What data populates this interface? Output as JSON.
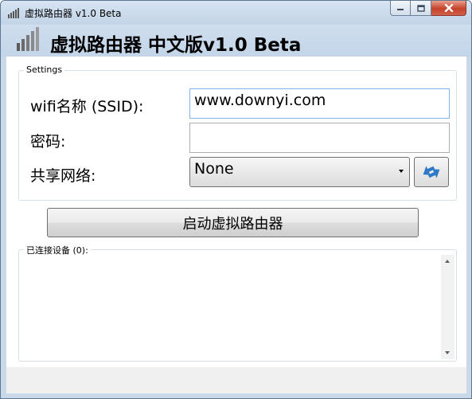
{
  "window": {
    "title": "虚拟路由器 v1.0 Beta",
    "header_title": "虚拟路由器 中文版v1.0 Beta"
  },
  "settings": {
    "legend": "Settings",
    "ssid_label": "wifi名称 (SSID):",
    "ssid_value": "www.downyi.com",
    "password_label": "密码:",
    "password_value": "",
    "share_label": "共享网络:",
    "share_selected": "None"
  },
  "actions": {
    "start_label": "启动虚拟路由器"
  },
  "devices": {
    "legend": "已连接设备 (0):"
  },
  "icons": {
    "app": "signal-bars-icon",
    "refresh": "refresh-arrows-icon",
    "minimize": "minimize-icon",
    "maximize": "maximize-icon",
    "close": "close-icon"
  },
  "colors": {
    "title_bar": "#c9d9ea",
    "close_button": "#c6412b",
    "refresh_arrows": "#2f78c7",
    "focus_border": "#7eb4ea"
  }
}
